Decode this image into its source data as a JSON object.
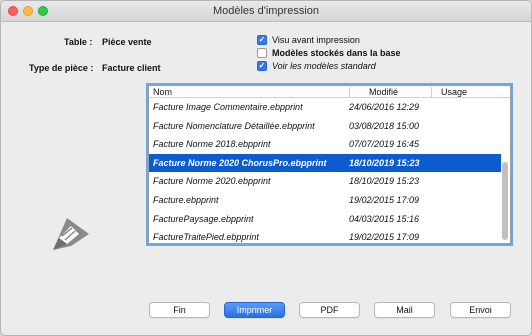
{
  "window": {
    "title": "Modèles d'impression"
  },
  "info": {
    "table_label": "Table :",
    "table_value": "Pièce vente",
    "type_label": "Type de pièce :",
    "type_value": "Facture client"
  },
  "options": [
    {
      "label": "Visu avant impression",
      "checked": true
    },
    {
      "label": "Modèles stockés dans la base",
      "checked": false
    },
    {
      "label": "Voir les modèles standard",
      "checked": true
    }
  ],
  "list": {
    "columns": [
      "Nom",
      "Modifié",
      "Usage"
    ],
    "rows": [
      {
        "name": "Facture Image Commentaire.ebpprint",
        "modified": "24/06/2016 12:29",
        "usage": "",
        "selected": false
      },
      {
        "name": "Facture Nomenclature Détaillée.ebpprint",
        "modified": "03/08/2018 15:00",
        "usage": "",
        "selected": false
      },
      {
        "name": "Facture Norme 2018.ebpprint",
        "modified": "07/07/2019 16:45",
        "usage": "",
        "selected": false
      },
      {
        "name": "Facture Norme 2020 ChorusPro.ebpprint",
        "modified": "18/10/2019 15:23",
        "usage": "",
        "selected": true
      },
      {
        "name": "Facture Norme 2020.ebpprint",
        "modified": "18/10/2019 15:23",
        "usage": "",
        "selected": false
      },
      {
        "name": "Facture.ebpprint",
        "modified": "19/02/2015 17:09",
        "usage": "",
        "selected": false
      },
      {
        "name": "FacturePaysage.ebpprint",
        "modified": "04/03/2015 15:16",
        "usage": "",
        "selected": false
      },
      {
        "name": "FactureTraitePied.ebpprint",
        "modified": "19/02/2015 17:09",
        "usage": "",
        "selected": false
      }
    ]
  },
  "buttons": {
    "fin": "Fin",
    "imprimer": "Imprimer",
    "pdf": "PDF",
    "mail": "Mail",
    "envoi": "Envoi"
  },
  "colors": {
    "accent": "#3478f6",
    "selection": "#0d5ccf"
  },
  "icons": {
    "logo": "print-document-icon"
  }
}
